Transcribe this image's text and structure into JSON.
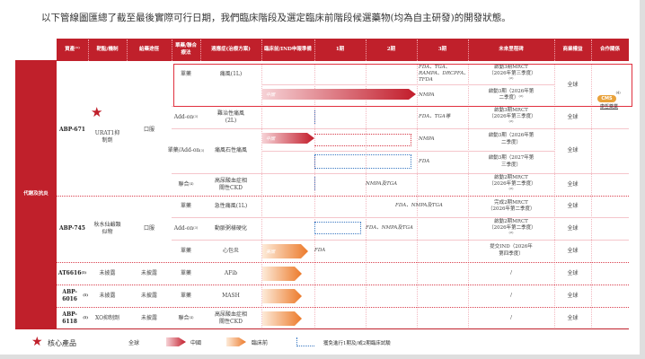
{
  "title": "以下管線圖匯總了截至最後實際可行日期，我們臨床階段及選定臨床前階段候選藥物(均為自主研發)的開發狀態。",
  "header": [
    "資產⁽¹⁾",
    "靶點/機制",
    "給藥途徑",
    "單藥/聯合療法",
    "適應症(治療方案)",
    "臨床前/IND申報準備",
    "1期",
    "2期",
    "3期",
    "未來里程碑",
    "商業權益",
    "合作關係"
  ],
  "category": "代謝及抗炎",
  "assets": [
    {
      "name": "ABP-671",
      "sup": "",
      "target": "URAT1抑制劑",
      "route": "口服",
      "core": true
    },
    {
      "name": "ABP-745",
      "sup": "",
      "target": "秋水仙鹼類似物",
      "route": "口服"
    },
    {
      "name": "AT6616",
      "sup": "(5)",
      "target": "未披露",
      "route": "未披露"
    },
    {
      "name": "ABP-6016",
      "sup": "(5)",
      "target": "未披露",
      "route": "未披露"
    },
    {
      "name": "ABP-6118",
      "sup": "(5)",
      "target": "XO抑制劑",
      "route": "未披露"
    }
  ],
  "rows": [
    {
      "mode": "單藥",
      "sup": "",
      "indication": "痛風(1L)",
      "regs": [
        "FDA、TGA、RAMPA、DRCPFA、TFDA",
        "NMPA"
      ],
      "milestones": [
        "啟動3期MRCT（2026年第三季度）⁽²⁾",
        "啟動3期（2026年第二季度）⁽²⁾"
      ],
      "rights": "全球",
      "bar_label": "中國"
    },
    {
      "mode": "Add-on",
      "sup": "(3)",
      "indication": "難治性痛風(2L)",
      "regs": [
        "FDA、TGA等"
      ],
      "milestones": [
        "啟動3期MRCT（2026年第三季度）⁽²⁾"
      ],
      "rights": "全球"
    },
    {
      "mode": "單藥/Add-on",
      "sup": "(3)",
      "indication": "痛風石性痛風",
      "regs": [
        "NMPA",
        "FDA"
      ],
      "milestones": [
        "啟動3期（2026年第二季度）",
        "啟動3期（2027年第三季度）"
      ],
      "rights": "全球",
      "bar_label": "中國"
    },
    {
      "mode": "聯合",
      "sup": "(4)",
      "indication": "高尿酸血症相關性CKD",
      "regs": [
        "NMPA及TGA"
      ],
      "milestones": [
        "啟動2期MRCT（2026年第二季度）⁽²⁾"
      ],
      "rights": "全球"
    },
    {
      "mode": "單藥",
      "sup": "",
      "indication": "急性痛風(1L)",
      "regs": [
        "FDA、NMPA及TGA"
      ],
      "milestones": [
        "完成2期MRCT（2026年第二季度）"
      ],
      "rights": "全球"
    },
    {
      "mode": "Add-on",
      "sup": "(3)",
      "indication": "動脈粥樣硬化",
      "regs": [
        "FDA、NMPA及TGA"
      ],
      "milestones": [
        "啟動2期MRCT（2026年第二季度）⁽²⁾"
      ],
      "rights": "全球"
    },
    {
      "mode": "單藥",
      "sup": "",
      "indication": "心包炎",
      "regs": [
        "FDA"
      ],
      "milestones": [
        "提交IND（2026年第四季度）"
      ],
      "rights": "全球",
      "bar_label": "美國"
    },
    {
      "mode": "單藥",
      "sup": "",
      "indication": "AFib",
      "regs": [],
      "milestones": [
        "/"
      ],
      "rights": "全球"
    },
    {
      "mode": "單藥",
      "sup": "",
      "indication": "MASH",
      "regs": [],
      "milestones": [
        "/"
      ],
      "rights": "全球"
    },
    {
      "mode": "聯合",
      "sup": "(4)",
      "indication": "高尿酸血症相關性CKD",
      "regs": [],
      "milestones": [
        "/"
      ],
      "rights": "全球"
    }
  ],
  "partner": {
    "logo": "CMS",
    "name": "康哲藥業",
    "sup": "(4)"
  },
  "legend": {
    "core": "核心產品",
    "global": "全球",
    "china": "中國",
    "preclinical": "臨床前",
    "waiver": "獲免進行1期及/或2期臨床試驗"
  },
  "colors": {
    "brand_red": "#c0202b",
    "china_bar": "#c21c2a",
    "preclinical_bar": "#ec7a2b",
    "waiver_outline": "#3a78c2"
  }
}
